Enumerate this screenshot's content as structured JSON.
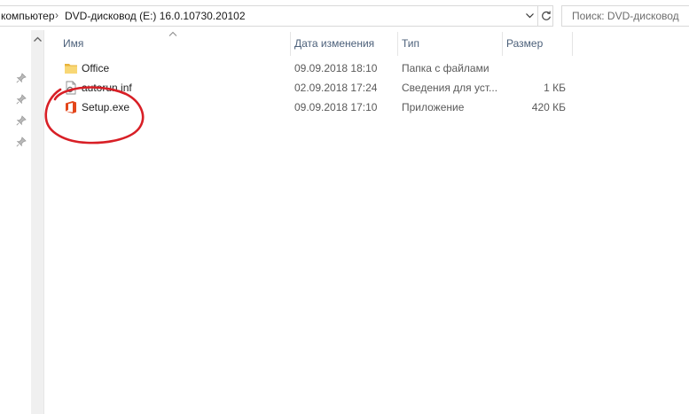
{
  "address": {
    "crumb_parent": "компьютер",
    "crumb_current": "DVD-дисковод (E:) 16.0.10730.20102"
  },
  "search": {
    "placeholder": "Поиск: DVD-дисковод"
  },
  "columns": {
    "name": "Имя",
    "date": "Дата изменения",
    "type": "Тип",
    "size": "Размер"
  },
  "files": [
    {
      "name": "Office",
      "date": "09.09.2018 18:10",
      "type": "Папка с файлами",
      "size": "",
      "icon": "folder-icon"
    },
    {
      "name": "autorun.inf",
      "date": "02.09.2018 17:24",
      "type": "Сведения для уст...",
      "size": "1 КБ",
      "icon": "settings-file-icon"
    },
    {
      "name": "Setup.exe",
      "date": "09.09.2018 17:10",
      "type": "Приложение",
      "size": "420 КБ",
      "icon": "office-setup-icon"
    }
  ],
  "colors": {
    "annotation": "#d81f26",
    "header_text": "#4c607a",
    "folder": "#f5c84c",
    "office": "#e3461b"
  }
}
